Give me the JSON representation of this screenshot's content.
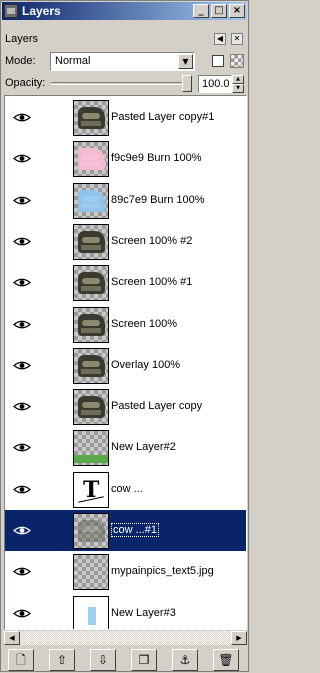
{
  "window": {
    "title": "Layers"
  },
  "panel": {
    "label": "Layers"
  },
  "mode": {
    "label": "Mode:",
    "value": "Normal"
  },
  "opacity": {
    "label": "Opacity:",
    "value": "100.0",
    "level_percent": 100
  },
  "layers": [
    {
      "name": "Pasted Layer copy#1",
      "thumb": "cow",
      "selected": false
    },
    {
      "name": "f9c9e9 Burn 100%",
      "thumb": "pink",
      "selected": false
    },
    {
      "name": "89c7e9 Burn 100%",
      "thumb": "blue",
      "selected": false
    },
    {
      "name": "Screen 100% #2",
      "thumb": "cow",
      "selected": false
    },
    {
      "name": "Screen 100% #1",
      "thumb": "cow",
      "selected": false
    },
    {
      "name": "Screen 100%",
      "thumb": "cow",
      "selected": false
    },
    {
      "name": "Overlay 100%",
      "thumb": "cow",
      "selected": false
    },
    {
      "name": "Pasted Layer copy",
      "thumb": "cow",
      "selected": false
    },
    {
      "name": "New Layer#2",
      "thumb": "green",
      "selected": false
    },
    {
      "name": "cow ...",
      "thumb": "text",
      "selected": false
    },
    {
      "name": "cow ...#1",
      "thumb": "sel",
      "selected": true
    },
    {
      "name": "mypainpics_text5.jpg",
      "thumb": "empty",
      "selected": false
    },
    {
      "name": "New Layer#3",
      "thumb": "white-blue",
      "selected": false
    }
  ],
  "toolbar": {
    "icons": [
      "new-layer-icon",
      "raise-layer-icon",
      "lower-layer-icon",
      "duplicate-layer-icon",
      "anchor-layer-icon",
      "delete-layer-icon"
    ],
    "glyphs": [
      "🗋",
      "⇧",
      "⇩",
      "❐",
      "⚓",
      "🗑"
    ]
  },
  "titlebar_buttons": {
    "minimize": "_",
    "maximize": "□",
    "close": "×"
  }
}
